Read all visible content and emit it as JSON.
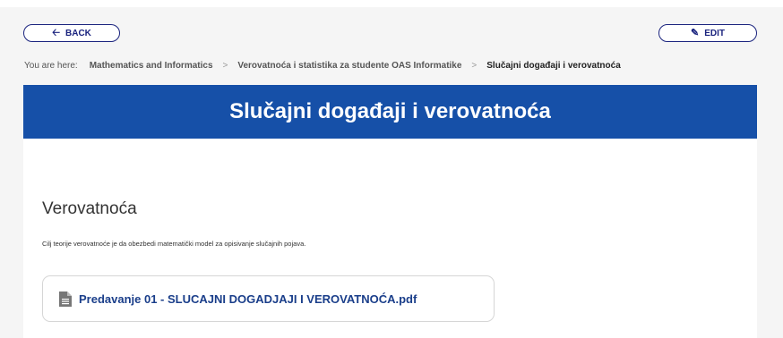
{
  "toolbar": {
    "back_label": "BACK",
    "edit_label": "EDIT",
    "back_icon": "arrow-left-icon",
    "edit_icon": "pencil-icon"
  },
  "breadcrumb": {
    "prefix": "You are here:",
    "items": [
      "Mathematics and Informatics",
      "Verovatnoća i statistika za studente OAS Informatike",
      "Slučajni događaji i verovatnoća"
    ],
    "separator": ">"
  },
  "page": {
    "title": "Slučajni događaji i verovatnoća"
  },
  "section": {
    "title": "Verovatnoća",
    "description": "Cilj teorije verovatnoće je da obezbedi matematički model za opisivanje slučajnih pojava.",
    "file": {
      "label": "Predavanje 01 - SLUCAJNI DOGADJAJI I VEROVATNOĆA.pdf",
      "icon": "document-icon"
    }
  },
  "colors": {
    "banner": "#1650a8",
    "accent": "#1a237e",
    "link": "#1a3e8a"
  }
}
